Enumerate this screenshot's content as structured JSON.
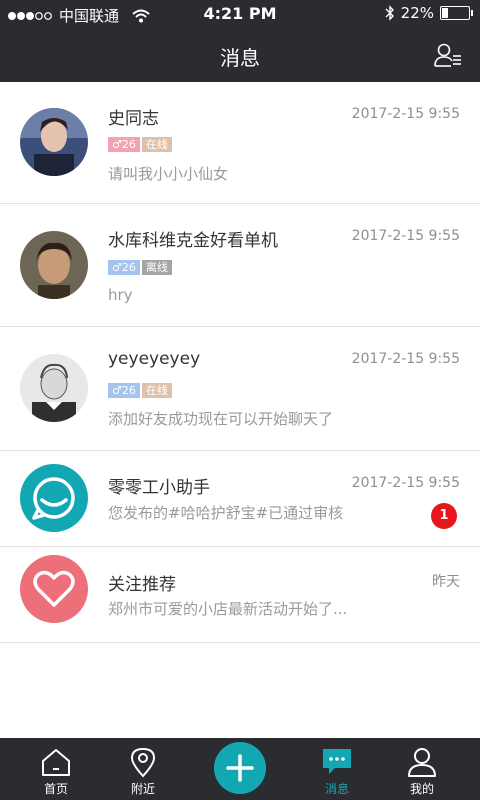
{
  "status": {
    "carrier": "中国联通",
    "time": "4:21 PM",
    "battery": "22%",
    "battery_level": 0.22
  },
  "header": {
    "title": "消息"
  },
  "conversations": [
    {
      "name": "史同志",
      "time": "2017-2-15  9:55",
      "gender_age": "♂26",
      "online": "在线",
      "message": "请叫我小小小仙女"
    },
    {
      "name": "水库科维克金好看单机",
      "time": "2017-2-15  9:55",
      "gender_age": "♂26",
      "online": "离线",
      "message": "hry"
    },
    {
      "name": "yeyeyeyey",
      "time": "2017-2-15  9:55",
      "gender_age": "♂26",
      "online": "在线",
      "message": "添加好友成功现在可以开始聊天了"
    },
    {
      "name": "零零工小助手",
      "time": "2017-2-15  9:55",
      "message": "您发布的#哈哈护舒宝#已通过审核",
      "badge": "1"
    },
    {
      "name": "关注推荐",
      "time": "昨天",
      "message": "郑州市可爱的小店最新活动开始了..."
    }
  ],
  "tabbar": {
    "home": "首页",
    "nearby": "附近",
    "messages": "消息",
    "mine": "我的"
  },
  "colors": {
    "dark": "#2b2c30",
    "accent": "#13a7b4",
    "tag_pink": "#f2a3b3",
    "tag_blue": "#a3c4ec",
    "tag_online": "#e0c1a8",
    "tag_offline": "#a5a5a5",
    "badge": "#e8161b"
  },
  "icons": {
    "signal": "signal-dots-icon",
    "wifi": "wifi-icon",
    "bluetooth": "bluetooth-icon",
    "battery": "battery-icon",
    "contacts": "contacts-list-icon",
    "assistant": "smile-chat-icon",
    "follow": "heart-icon",
    "home": "home-icon",
    "nearby": "location-pin-icon",
    "add": "plus-icon",
    "messages": "chat-bubble-icon",
    "mine": "person-icon"
  }
}
